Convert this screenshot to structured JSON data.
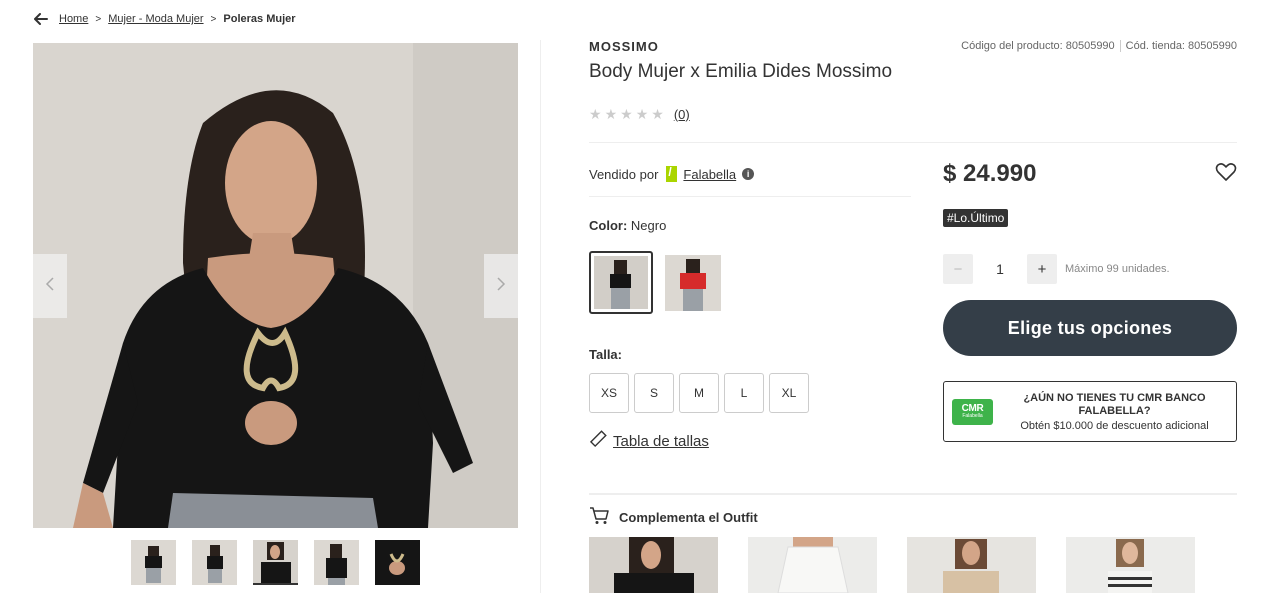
{
  "breadcrumb": {
    "items": [
      "Home",
      "Mujer - Moda Mujer"
    ],
    "separator": ">",
    "current": "Poleras Mujer"
  },
  "product": {
    "brand": "MOSSIMO",
    "title": "Body Mujer x Emilia Dides Mossimo",
    "product_code": "Código del producto: 80505990",
    "store_code": "Cód. tienda: 80505990",
    "rating_count": "(0)",
    "stars_filled": 0,
    "stars_total": 5
  },
  "seller": {
    "label": "Vendido por",
    "name": "Falabella",
    "logo_color": "#aad500"
  },
  "color": {
    "label": "Color:",
    "value": "Negro",
    "swatches": [
      "black-body",
      "red-top"
    ]
  },
  "size": {
    "label": "Talla:",
    "options": [
      "XS",
      "S",
      "M",
      "L",
      "XL"
    ],
    "table_link": "Tabla de tallas"
  },
  "price": {
    "value": "$ 24.990",
    "badge": "#Lo.Último"
  },
  "quantity": {
    "minus": "−",
    "value": "1",
    "plus": "+",
    "max_text": "Máximo 99 unidades."
  },
  "cta": {
    "label": "Elige tus opciones",
    "bg_color": "#343e48"
  },
  "cmr": {
    "card_text": "CMR",
    "card_sub": "Falabella",
    "headline": "¿AÚN NO TIENES TU CMR BANCO FALABELLA?",
    "subtext": "Obtén $10.000 de descuento adicional",
    "card_color": "#3eb34a"
  },
  "outfit": {
    "title": "Complementa el Outfit",
    "items": [
      "black-body",
      "white-skirt",
      "beige-top",
      "striped-top"
    ]
  },
  "gallery": {
    "thumbnails": 5,
    "active_index": 2
  },
  "icons": {
    "back": "arrow-left-icon",
    "prev": "chevron-left-icon",
    "next": "chevron-right-icon",
    "heart": "heart-icon",
    "info": "info-icon",
    "ruler": "ruler-icon",
    "cart": "cart-icon"
  }
}
